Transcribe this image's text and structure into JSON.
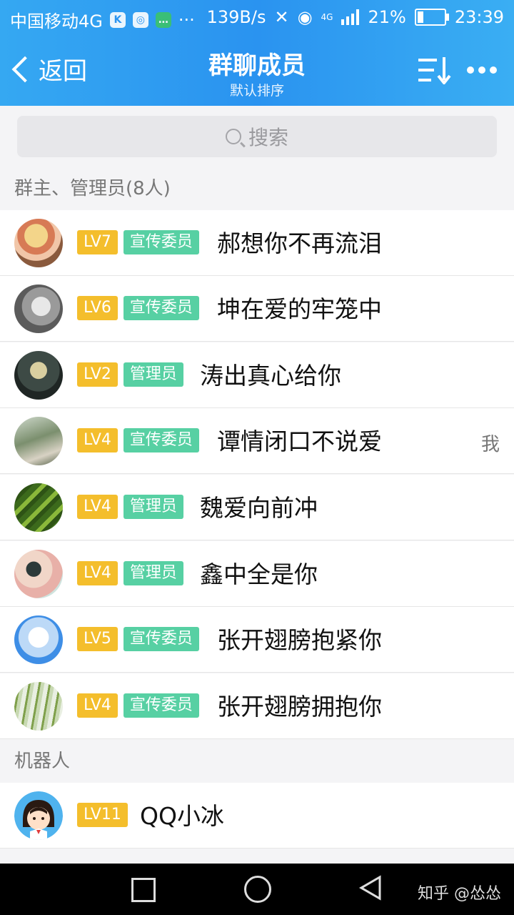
{
  "status_bar": {
    "carrier": "中国移动4G",
    "net_speed": "139B/s",
    "network_type": "4G",
    "battery_percent": "21%",
    "time": "23:39",
    "more": "···"
  },
  "header": {
    "back_label": "返回",
    "title": "群聊成员",
    "subtitle": "默认排序",
    "sort_icon": "sort-icon",
    "more_icon": "more-icon"
  },
  "search": {
    "placeholder": "搜索"
  },
  "sections": {
    "admins_label": "群主、管理员(8人)",
    "robots_label": "机器人"
  },
  "members": [
    {
      "level": "LV7",
      "role": "宣传委员",
      "name": "郝想你不再流泪",
      "me": ""
    },
    {
      "level": "LV6",
      "role": "宣传委员",
      "name": "坤在爱的牢笼中",
      "me": ""
    },
    {
      "level": "LV2",
      "role": "管理员",
      "name": "涛出真心给你",
      "me": ""
    },
    {
      "level": "LV4",
      "role": "宣传委员",
      "name": "谭情闭口不说爱",
      "me": "我"
    },
    {
      "level": "LV4",
      "role": "管理员",
      "name": "魏爱向前冲",
      "me": ""
    },
    {
      "level": "LV4",
      "role": "管理员",
      "name": "鑫中全是你",
      "me": ""
    },
    {
      "level": "LV5",
      "role": "宣传委员",
      "name": "张开翅膀抱紧你",
      "me": ""
    },
    {
      "level": "LV4",
      "role": "宣传委员",
      "name": "张开翅膀拥抱你",
      "me": ""
    }
  ],
  "robots": [
    {
      "level": "LV11",
      "name": "QQ小冰"
    }
  ],
  "watermark": "知乎 @怂怂",
  "colors": {
    "header_blue": "#2a93f0",
    "level_badge": "#f4be2c",
    "role_badge": "#57d0a3"
  }
}
